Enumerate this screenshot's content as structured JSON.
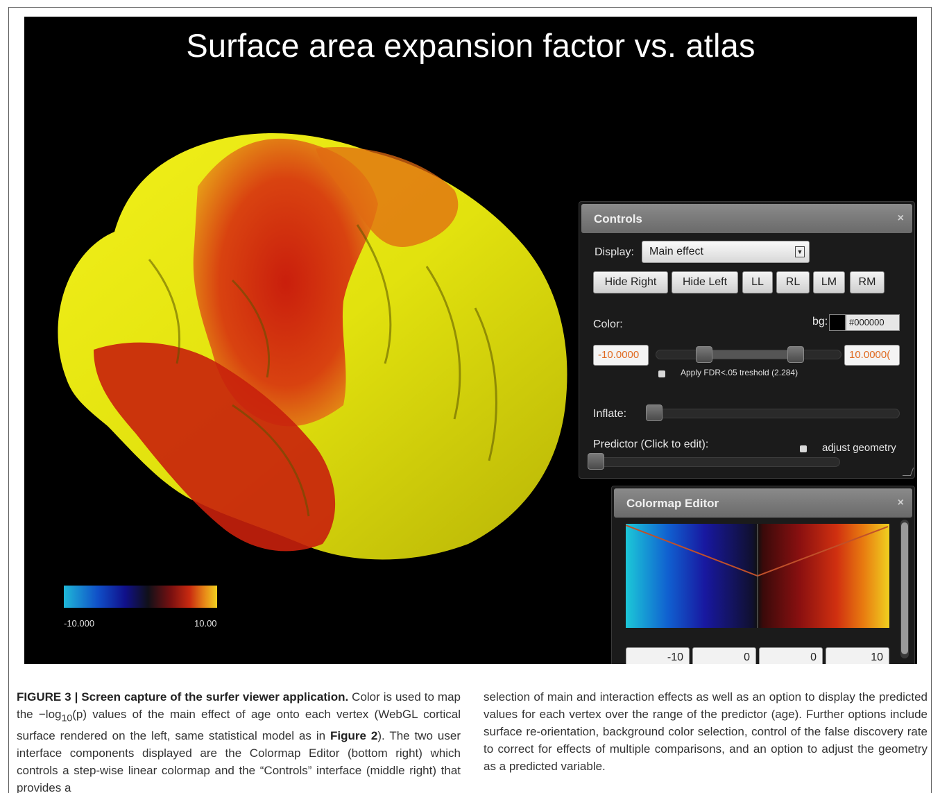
{
  "viewer": {
    "title": "Surface area expansion factor vs. atlas",
    "legend": {
      "min_label": "-10.000",
      "max_label": "10.00"
    }
  },
  "controls": {
    "title": "Controls",
    "close": "×",
    "display_label": "Display:",
    "display_value": "Main effect",
    "buttons": {
      "hide_right": "Hide Right",
      "hide_left": "Hide Left",
      "ll": "LL",
      "rl": "RL",
      "lm": "LM",
      "rm": "RM"
    },
    "color_label": "Color:",
    "bg_label": "bg:",
    "bg_value": "#000000",
    "bg_color": "#000000",
    "range_min": "-10.0000",
    "range_max": "10.0000(",
    "fdr_label": "Apply FDR<.05 treshold (2.284)",
    "inflate_label": "Inflate:",
    "predictor_label": "Predictor (Click to edit):",
    "adjust_label": "adjust geometry"
  },
  "colormap_editor": {
    "title": "Colormap Editor",
    "close": "×",
    "fields": [
      "-10",
      "0",
      "0",
      "10"
    ]
  },
  "caption": {
    "fig_label": "FIGURE 3 | Screen capture of the surfer viewer application.",
    "p1a": " Color is used to map the −log",
    "sub": "10",
    "p1b": "(p) values of the main effect of age onto each vertex (WebGL cortical surface rendered on the left, same statistical model as in ",
    "fig2": "Figure 2",
    "p1c": "). The two user interface components displayed are the Colormap Editor (bottom right) which controls a step-wise linear colormap and the “Controls” interface (middle right) that provides a",
    "right": "selection of main and interaction effects as well as an option to display the predicted values for each vertex over the range of the predictor (age). Further options include surface re-orientation, background color selection, control of the false discovery rate to correct for effects of multiple comparisons, and an option to adjust the geometry as a predicted variable."
  }
}
